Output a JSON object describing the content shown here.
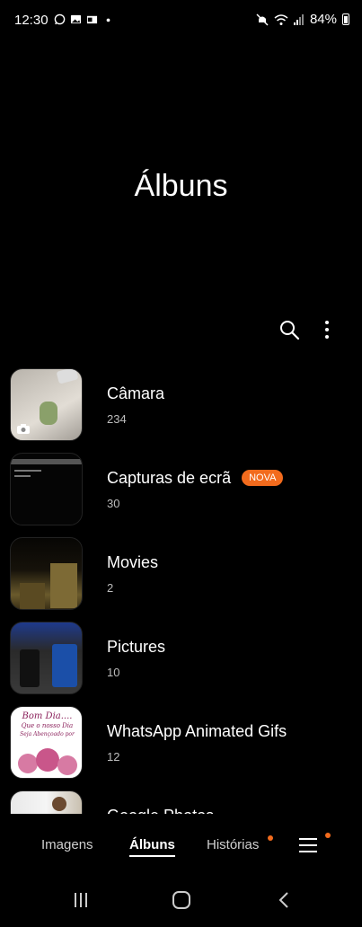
{
  "status": {
    "time": "12:30",
    "battery": "84%"
  },
  "page": {
    "title": "Álbuns"
  },
  "albums": [
    {
      "name": "Câmara",
      "count": "234",
      "badge": ""
    },
    {
      "name": "Capturas de ecrã",
      "count": "30",
      "badge": "NOVA"
    },
    {
      "name": "Movies",
      "count": "2",
      "badge": ""
    },
    {
      "name": "Pictures",
      "count": "10",
      "badge": ""
    },
    {
      "name": "WhatsApp Animated Gifs",
      "count": "12",
      "badge": ""
    },
    {
      "name": "Google Photos",
      "count": "",
      "badge": ""
    }
  ],
  "tabs": {
    "images": "Imagens",
    "albums": "Álbuns",
    "stories": "Histórias"
  },
  "thumb_text": {
    "line1": "Bom Dia....",
    "line2": "Que o nosso Dia",
    "line3": "Seja Abençoado por"
  },
  "colors": {
    "accent": "#f26b1d",
    "background": "#000000"
  }
}
